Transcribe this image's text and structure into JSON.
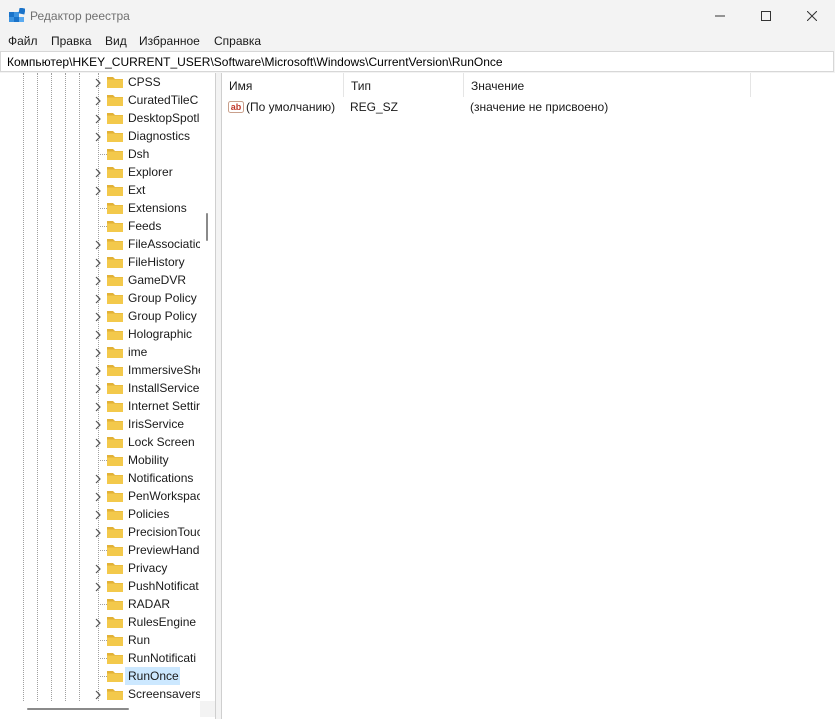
{
  "window": {
    "title": "Редактор реестра",
    "controls": [
      "minimize-icon",
      "maximize-icon",
      "close-icon"
    ]
  },
  "menu": [
    "Файл",
    "Правка",
    "Вид",
    "Избранное",
    "Справка"
  ],
  "address": "Компьютер\\HKEY_CURRENT_USER\\Software\\Microsoft\\Windows\\CurrentVersion\\RunOnce",
  "tree": {
    "items": [
      {
        "label": "CPSS",
        "expandable": true
      },
      {
        "label": "CuratedTileC",
        "expandable": true
      },
      {
        "label": "DesktopSpotl",
        "expandable": true
      },
      {
        "label": "Diagnostics",
        "expandable": true
      },
      {
        "label": "Dsh",
        "expandable": false
      },
      {
        "label": "Explorer",
        "expandable": true
      },
      {
        "label": "Ext",
        "expandable": true
      },
      {
        "label": "Extensions",
        "expandable": false
      },
      {
        "label": "Feeds",
        "expandable": false
      },
      {
        "label": "FileAssociatic",
        "expandable": true
      },
      {
        "label": "FileHistory",
        "expandable": true
      },
      {
        "label": "GameDVR",
        "expandable": true
      },
      {
        "label": "Group Policy",
        "expandable": true
      },
      {
        "label": "Group Policy",
        "expandable": true
      },
      {
        "label": "Holographic",
        "expandable": true
      },
      {
        "label": "ime",
        "expandable": true
      },
      {
        "label": "ImmersiveShe",
        "expandable": true
      },
      {
        "label": "InstallService",
        "expandable": true
      },
      {
        "label": "Internet Settir",
        "expandable": true
      },
      {
        "label": "IrisService",
        "expandable": true
      },
      {
        "label": "Lock Screen",
        "expandable": true
      },
      {
        "label": "Mobility",
        "expandable": false
      },
      {
        "label": "Notifications",
        "expandable": true
      },
      {
        "label": "PenWorkspac",
        "expandable": true
      },
      {
        "label": "Policies",
        "expandable": true
      },
      {
        "label": "PrecisionTouc",
        "expandable": true
      },
      {
        "label": "PreviewHand",
        "expandable": false
      },
      {
        "label": "Privacy",
        "expandable": true
      },
      {
        "label": "PushNotificat",
        "expandable": true
      },
      {
        "label": "RADAR",
        "expandable": false
      },
      {
        "label": "RulesEngine",
        "expandable": true
      },
      {
        "label": "Run",
        "expandable": false
      },
      {
        "label": "RunNotificati",
        "expandable": false
      },
      {
        "label": "RunOnce",
        "expandable": false,
        "selected": true
      },
      {
        "label": "Screensavers",
        "expandable": true
      }
    ]
  },
  "list": {
    "columns": [
      "Имя",
      "Тип",
      "Значение"
    ],
    "rows": [
      {
        "icon": "string-value-icon",
        "name": "(По умолчанию)",
        "type": "REG_SZ",
        "value": "(значение не присвоено)"
      }
    ]
  },
  "colors": {
    "folder": "#f3c94b",
    "folder_dark": "#e2b136",
    "selection": "#cce8ff",
    "accent": "#0a64c8"
  }
}
